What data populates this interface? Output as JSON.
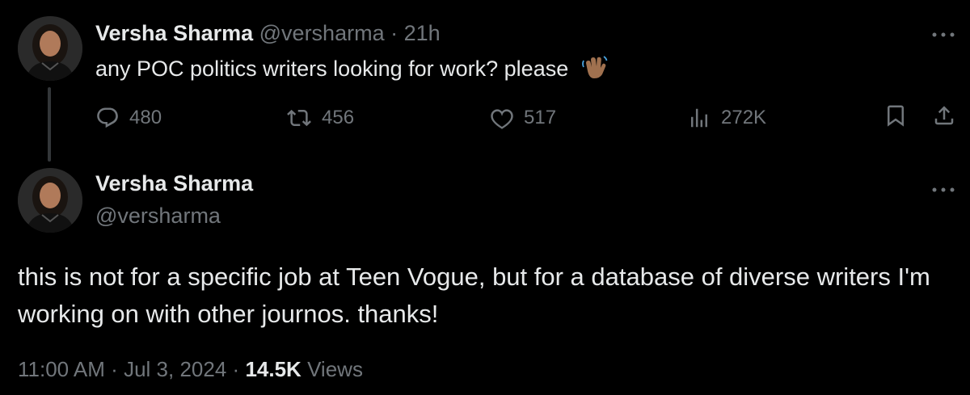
{
  "tweet1": {
    "author_name": "Versha Sharma",
    "handle": "@versharma",
    "separator": "·",
    "time": "21h",
    "text": "any POC politics writers looking for work? please",
    "emoji_icon": "waving-hand-icon",
    "more_icon": "more-icon",
    "actions": {
      "replies": "480",
      "retweets": "456",
      "likes": "517",
      "views": "272K",
      "reply_icon": "reply-icon",
      "retweet_icon": "retweet-icon",
      "like_icon": "heart-icon",
      "views_icon": "analytics-icon",
      "bookmark_icon": "bookmark-icon",
      "share_icon": "share-icon"
    }
  },
  "tweet2": {
    "author_name": "Versha Sharma",
    "handle": "@versharma",
    "text": "this is not for a specific job at Teen Vogue, but for a database of diverse writers I'm working on with other journos. thanks!",
    "more_icon": "more-icon",
    "time": "11:00 AM",
    "date": "Jul 3, 2024",
    "separator": "·",
    "views_count": "14.5K",
    "views_label": "Views"
  },
  "colors": {
    "background": "#000000",
    "text": "#e7e9ea",
    "muted": "#71767b",
    "thread_line": "#333639"
  }
}
